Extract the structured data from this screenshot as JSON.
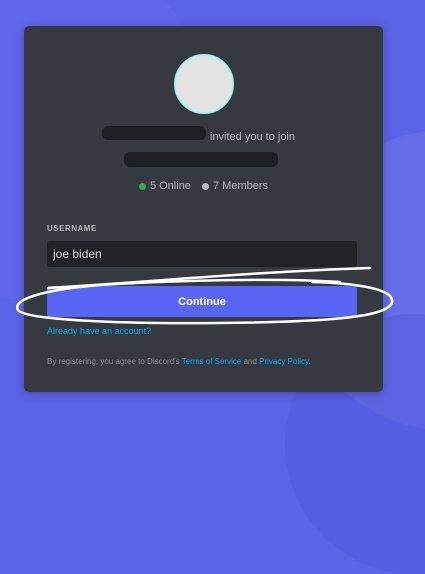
{
  "invite": {
    "invited_text": "invited you to join",
    "online_text": "5 Online",
    "members_text": "7 Members"
  },
  "form": {
    "username_label": "USERNAME",
    "username_value": "joe biden",
    "continue_label": "Continue",
    "login_link": "Already have an account?"
  },
  "legal": {
    "prefix": "By registering, you agree to Discord's ",
    "tos": "Terms of Service",
    "and": " and ",
    "privacy": "Privacy Policy",
    "suffix": "."
  },
  "colors": {
    "background": "#5b63e6",
    "modal": "#36393f",
    "accent": "#5865f2",
    "link": "#00aff4",
    "online": "#3ba55c"
  },
  "annotation": {
    "color": "#ffffff",
    "type": "hand-drawn scribble"
  }
}
